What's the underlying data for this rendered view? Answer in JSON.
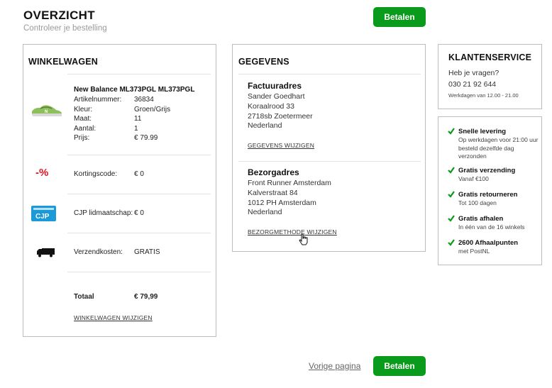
{
  "header": {
    "title": "OVERZICHT",
    "subtitle": "Controleer je bestelling",
    "pay_button": "Betalen"
  },
  "cart": {
    "heading": "WINKELWAGEN",
    "product": {
      "name": "New Balance ML373PGL ML373PGL",
      "fields": [
        {
          "label": "Artikelnummer:",
          "value": "36834"
        },
        {
          "label": "Kleur:",
          "value": "Groen/Grijs"
        },
        {
          "label": "Maat:",
          "value": "11"
        },
        {
          "label": "Aantal:",
          "value": "1"
        },
        {
          "label": "Prijs:",
          "value": "€ 79.99"
        }
      ]
    },
    "discount": {
      "icon_text": "-%",
      "label": "Kortingscode:",
      "value": "€ 0"
    },
    "cjp": {
      "icon_text": "CJP",
      "label": "CJP lidmaatschap:",
      "value": "€ 0"
    },
    "shipping": {
      "label": "Verzendkosten:",
      "value": "GRATIS"
    },
    "total": {
      "label": "Totaal",
      "value": "€ 79,99"
    },
    "edit_link": "WINKELWAGEN WIJZIGEN"
  },
  "gegevens": {
    "heading": "GEGEVENS",
    "billing": {
      "title": "Factuuradres",
      "lines": [
        "Sander Goedhart",
        "Koraalrood 33",
        "2718sb Zoetermeer",
        "Nederland"
      ],
      "edit_link": "GEGEVENS WIJZIGEN"
    },
    "delivery": {
      "title": "Bezorgadres",
      "lines": [
        "Front Runner Amsterdam",
        "Kalverstraat 84",
        "1012 PH Amsterdam",
        "Nederland"
      ],
      "edit_link": "BEZORGMETHODE WIJZIGEN"
    }
  },
  "klantenservice": {
    "heading": "KLANTENSERVICE",
    "question": "Heb je vragen?",
    "phone": "030 21 92 644",
    "hours": "Werkdagen van 12.00 - 21.00"
  },
  "usps": [
    {
      "title": "Snelle levering",
      "desc": "Op werkdagen voor 21:00 uur besteld dezelfde dag verzonden"
    },
    {
      "title": "Gratis verzending",
      "desc": "Vanaf €100"
    },
    {
      "title": "Gratis retourneren",
      "desc": "Tot 100 dagen"
    },
    {
      "title": "Gratis afhalen",
      "desc": "In één van de 16 winkels"
    },
    {
      "title": "2600 Afhaalpunten",
      "desc": "met PostNL"
    }
  ],
  "footer": {
    "prev_link": "Vorige pagina",
    "pay_button": "Betalen"
  },
  "colors": {
    "accent_green": "#0a9a1c",
    "discount_red": "#e0141e",
    "cjp_blue": "#1a9ad6",
    "border": "#bdbdbd"
  }
}
